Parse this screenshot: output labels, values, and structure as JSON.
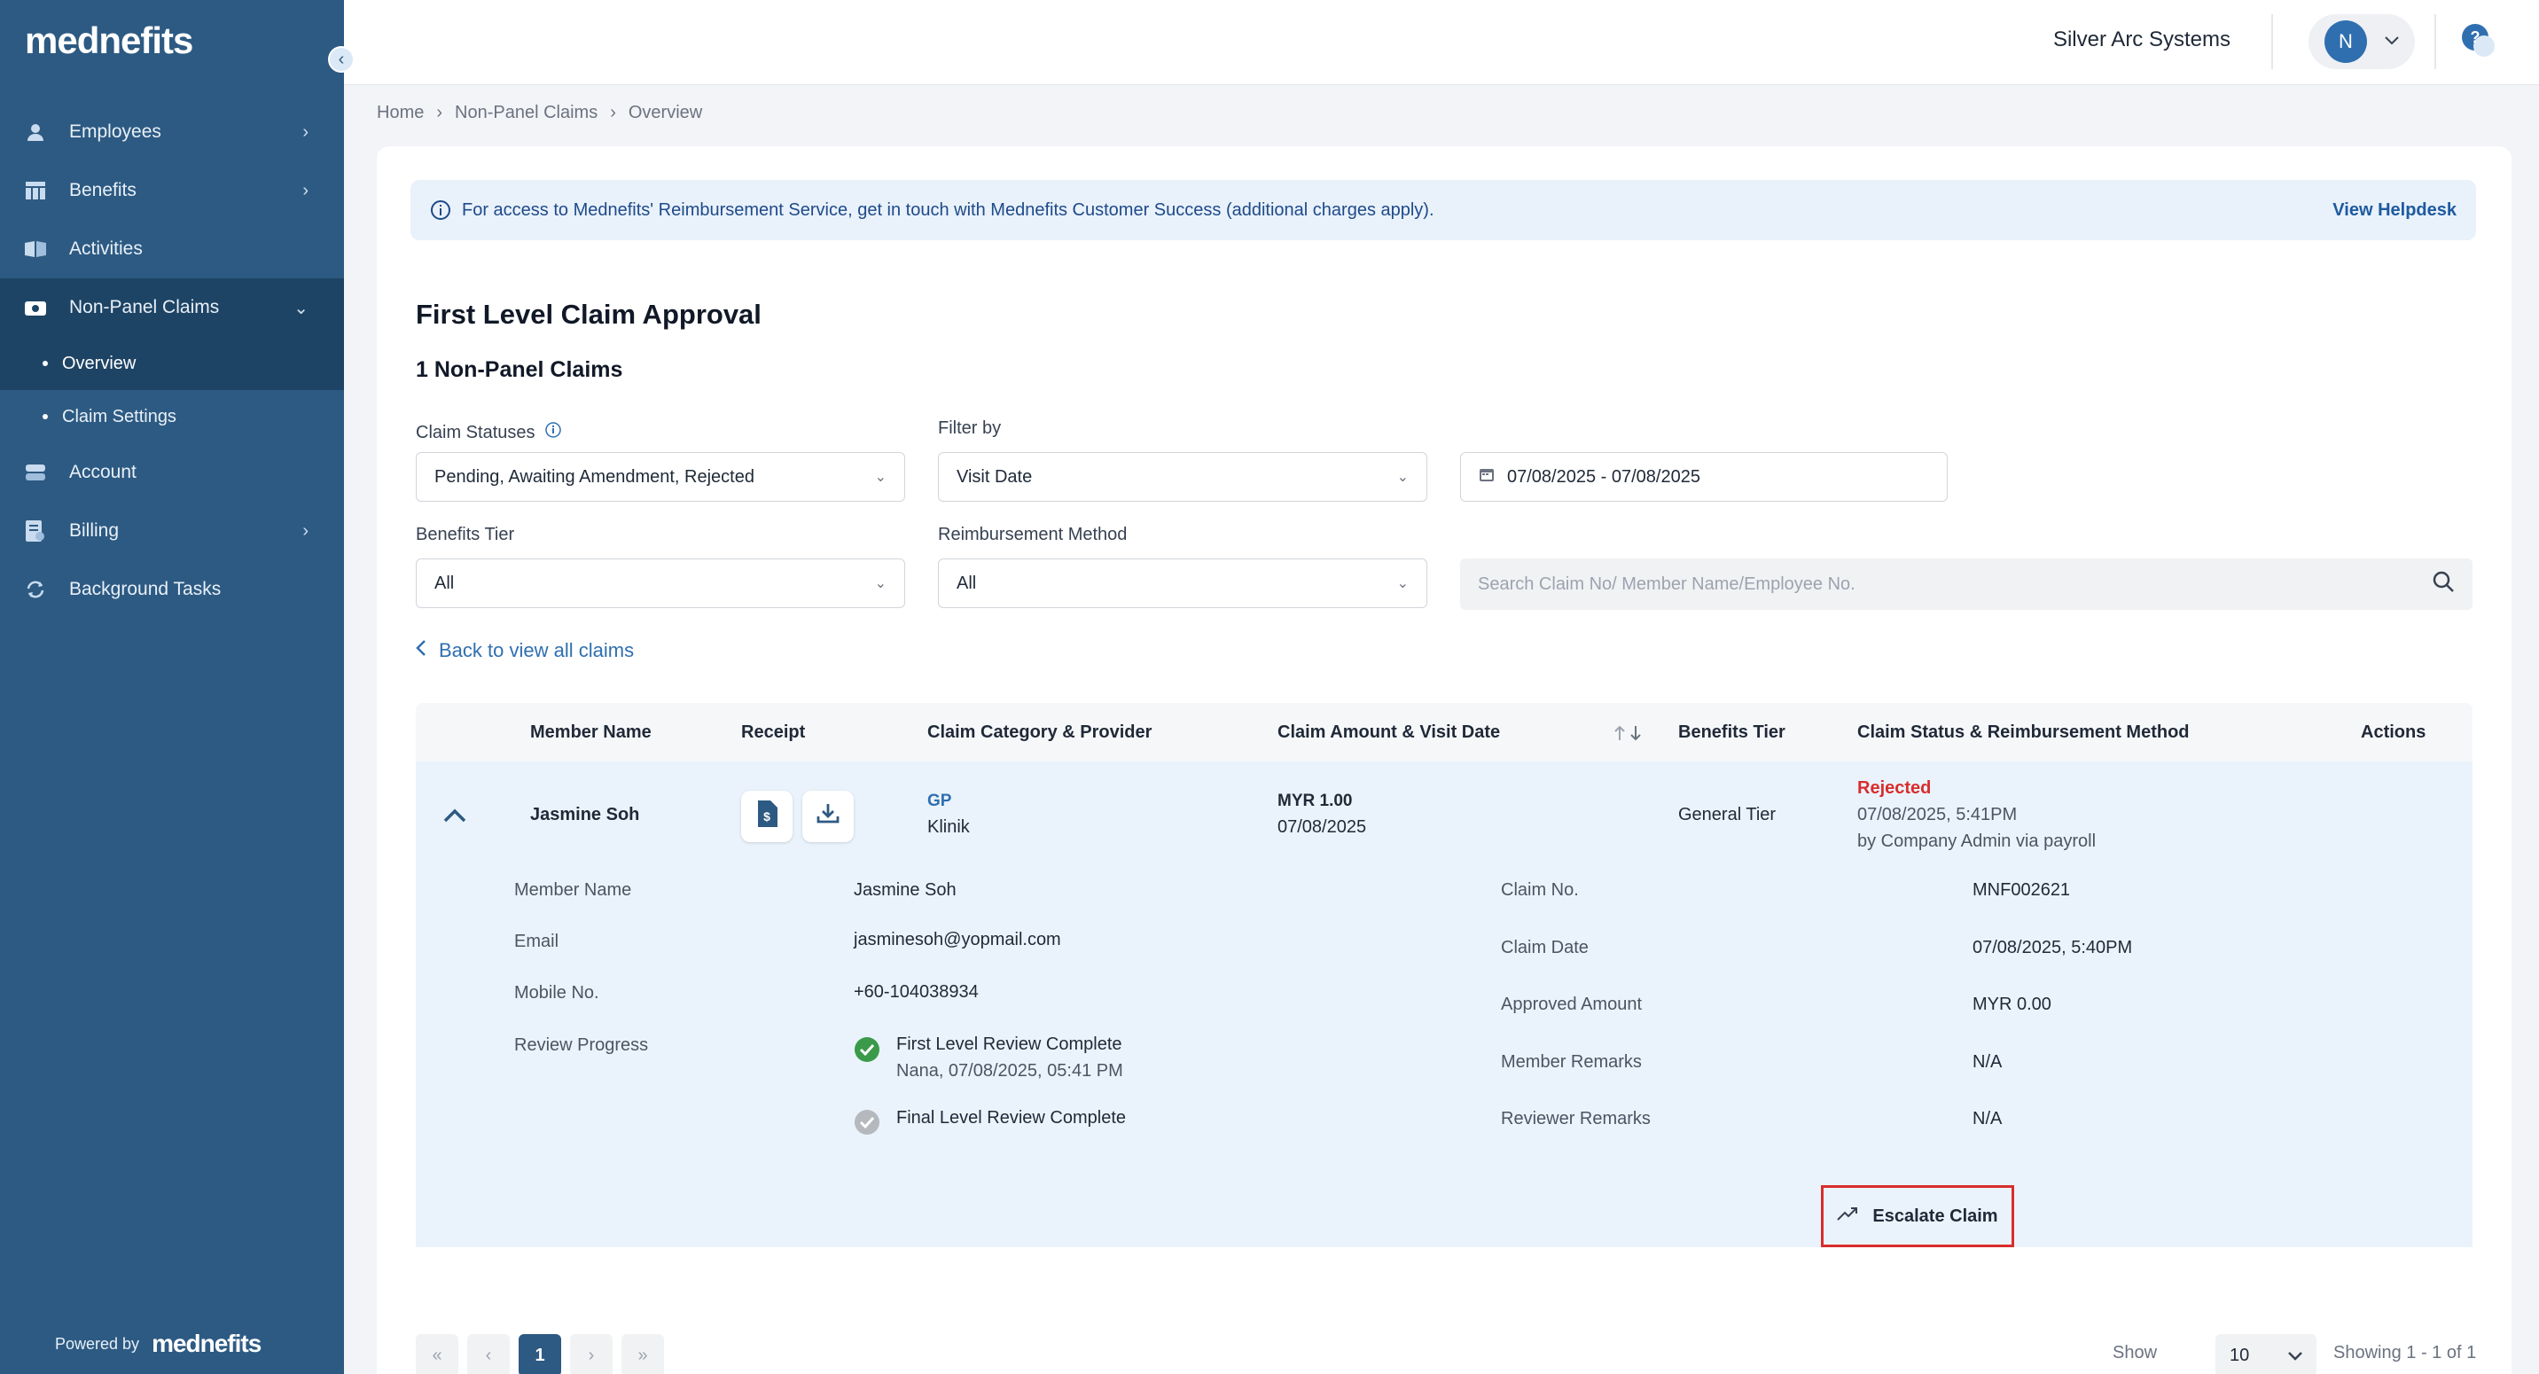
{
  "brand": {
    "logo": "mednefits",
    "powered_by": "Powered by",
    "powered_logo": "mednefits"
  },
  "sidebar": {
    "items": [
      {
        "label": "Employees",
        "icon": "user-icon"
      },
      {
        "label": "Benefits",
        "icon": "table-icon"
      },
      {
        "label": "Activities",
        "icon": "book-icon"
      },
      {
        "label": "Non-Panel Claims",
        "icon": "camera-icon"
      },
      {
        "label": "Account",
        "icon": "account-icon"
      },
      {
        "label": "Billing",
        "icon": "billing-icon"
      },
      {
        "label": "Background Tasks",
        "icon": "sync-icon"
      }
    ],
    "sub_items": [
      {
        "label": "Overview"
      },
      {
        "label": "Claim Settings"
      }
    ]
  },
  "header": {
    "company": "Silver Arc Systems",
    "avatar_initial": "N"
  },
  "breadcrumb": [
    "Home",
    "Non-Panel Claims",
    "Overview"
  ],
  "banner": {
    "text": "For access to Mednefits' Reimbursement Service, get in touch with Mednefits Customer Success (additional charges apply).",
    "link": "View Helpdesk"
  },
  "page": {
    "title": "First Level Claim Approval",
    "subtitle": "1 Non-Panel Claims"
  },
  "filters": {
    "claim_statuses_label": "Claim Statuses",
    "claim_statuses_value": "Pending, Awaiting Amendment, Rejected",
    "filter_by_label": "Filter by",
    "filter_by_value": "Visit Date",
    "date_range": "07/08/2025 - 07/08/2025",
    "benefits_tier_label": "Benefits Tier",
    "benefits_tier_value": "All",
    "reimbursement_label": "Reimbursement Method",
    "reimbursement_value": "All",
    "search_placeholder": "Search Claim No/ Member Name/Employee No."
  },
  "back_link": "Back to view all claims",
  "table": {
    "headers": {
      "member": "Member Name",
      "receipt": "Receipt",
      "category": "Claim Category & Provider",
      "amount": "Claim Amount & Visit Date",
      "tier": "Benefits Tier",
      "status": "Claim Status & Reimbursement Method",
      "actions": "Actions"
    },
    "row": {
      "member": "Jasmine Soh",
      "category": "GP",
      "provider": "Klinik",
      "amount": "MYR 1.00",
      "visit_date": "07/08/2025",
      "tier": "General Tier",
      "status": "Rejected",
      "status_time": "07/08/2025, 5:41PM",
      "status_by": "by Company Admin via payroll"
    },
    "detail": {
      "member_name_label": "Member Name",
      "member_name": "Jasmine Soh",
      "email_label": "Email",
      "email": "jasminesoh@yopmail.com",
      "mobile_label": "Mobile No.",
      "mobile": "+60-104038934",
      "review_label": "Review Progress",
      "review_first": "First Level Review Complete",
      "review_first_meta": "Nana, 07/08/2025, 05:41 PM",
      "review_final": "Final Level Review Complete",
      "claim_no_label": "Claim No.",
      "claim_no": "MNF002621",
      "claim_date_label": "Claim Date",
      "claim_date": "07/08/2025, 5:40PM",
      "approved_label": "Approved Amount",
      "approved": "MYR 0.00",
      "member_remarks_label": "Member Remarks",
      "member_remarks": "N/A",
      "reviewer_remarks_label": "Reviewer Remarks",
      "reviewer_remarks": "N/A"
    },
    "escalate": "Escalate Claim"
  },
  "pagination": {
    "current": "1",
    "show_label": "Show",
    "per_page": "10",
    "showing": "Showing 1 - 1 of 1"
  },
  "colors": {
    "sidebar": "#2d5a82",
    "accent": "#2f6fb0",
    "rejected": "#d92d2d",
    "highlight_border": "#d92d2d"
  }
}
